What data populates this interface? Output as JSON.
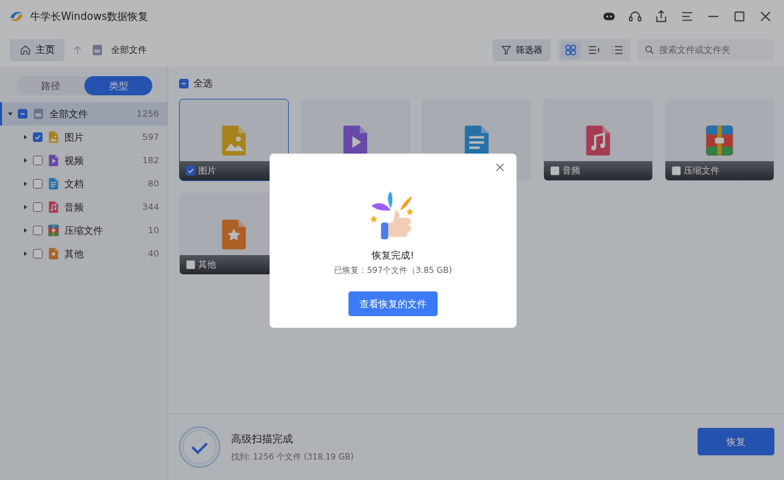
{
  "window": {
    "title": "牛学长Windows数据恢复"
  },
  "toolbar": {
    "home": "主页",
    "breadcrumb": "全部文件",
    "filter": "筛选器",
    "views": [
      {
        "kind": "grid",
        "selected": true
      },
      {
        "kind": "detail",
        "selected": false
      },
      {
        "kind": "list",
        "selected": false
      }
    ],
    "search": {
      "placeholder": "搜索文件或文件夹"
    }
  },
  "sidebar": {
    "tabs": [
      {
        "label": "路径",
        "selected": false
      },
      {
        "label": "类型",
        "selected": true
      }
    ],
    "tree": {
      "label": "全部文件",
      "count": "1256",
      "kind": "drive",
      "checked": false,
      "mixed": true,
      "expanded": true,
      "selected": true,
      "children": [
        {
          "label": "图片",
          "count": "597",
          "kind": "image",
          "checked": true,
          "mixed": false,
          "expanded": false
        },
        {
          "label": "视频",
          "count": "182",
          "kind": "video",
          "checked": false,
          "mixed": false,
          "expanded": false
        },
        {
          "label": "文档",
          "count": "80",
          "kind": "document",
          "checked": false,
          "mixed": false,
          "expanded": false
        },
        {
          "label": "音频",
          "count": "344",
          "kind": "audio",
          "checked": false,
          "mixed": false,
          "expanded": false
        },
        {
          "label": "压缩文件",
          "count": "10",
          "kind": "archive",
          "checked": false,
          "mixed": false,
          "expanded": false
        },
        {
          "label": "其他",
          "count": "40",
          "kind": "other",
          "checked": false,
          "mixed": false,
          "expanded": false
        }
      ]
    }
  },
  "content": {
    "select_all": {
      "label": "全选",
      "checked": false,
      "mixed": true
    },
    "cards": [
      {
        "kind": "image",
        "label": "图片",
        "checked": true,
        "selected": true
      },
      {
        "kind": "video",
        "selected": false
      },
      {
        "kind": "document",
        "selected": false
      },
      {
        "kind": "audio",
        "label": "音频",
        "checked": false,
        "selected": false
      },
      {
        "kind": "archive",
        "label": "压缩文件",
        "checked": false,
        "selected": false
      },
      {
        "kind": "other",
        "label": "其他",
        "checked": false,
        "selected": false
      }
    ]
  },
  "status": {
    "title": "高级扫描完成",
    "detail": "找到: 1256 个文件 (318.19 GB)",
    "button": "恢复"
  },
  "dialog": {
    "title": "恢复完成!",
    "detail": "已恢复：597个文件（3.85 GB)",
    "button": "查看恢复的文件"
  }
}
